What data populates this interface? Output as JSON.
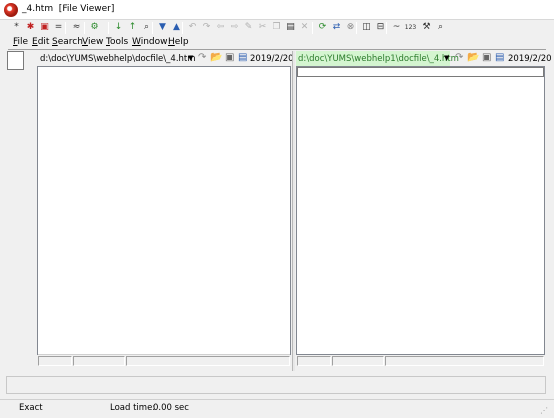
{
  "window": {
    "title": "_4.htm  [File Viewer]"
  },
  "toolbar": {
    "buttons": [
      {
        "icon": "asterisk-icon",
        "glyph": "*"
      },
      {
        "icon": "red-asterisk-icon",
        "glyph": "✱"
      },
      {
        "icon": "red-box-icon",
        "glyph": "▣"
      },
      {
        "icon": "equals-icon",
        "glyph": "="
      },
      {
        "icon": "approx-icon",
        "glyph": "≈"
      },
      {
        "icon": "green-gear-icon",
        "glyph": "⚙"
      },
      {
        "icon": "down-arrow-icon",
        "glyph": "↓"
      },
      {
        "icon": "up-arrow-icon",
        "glyph": "↑"
      },
      {
        "icon": "binoculars-icon",
        "glyph": "⌕"
      },
      {
        "icon": "down-triangle-icon",
        "glyph": "▼"
      },
      {
        "icon": "up-triangle-icon",
        "glyph": "▲"
      },
      {
        "icon": "undo-icon",
        "glyph": "↶"
      },
      {
        "icon": "redo-icon",
        "glyph": "↷"
      },
      {
        "icon": "back-icon",
        "glyph": "⇦"
      },
      {
        "icon": "forward-icon",
        "glyph": "⇨"
      },
      {
        "icon": "pencil-icon",
        "glyph": "✎"
      },
      {
        "icon": "scissors-icon",
        "glyph": "✂"
      },
      {
        "icon": "copy-icon",
        "glyph": "❐"
      },
      {
        "icon": "paste-icon",
        "glyph": "▤"
      },
      {
        "icon": "delete-icon",
        "glyph": "✕"
      },
      {
        "icon": "refresh-icon",
        "glyph": "⟳"
      },
      {
        "icon": "swap-icon",
        "glyph": "⇄"
      },
      {
        "icon": "stop-icon",
        "glyph": "⊗"
      },
      {
        "icon": "split-vertical-icon",
        "glyph": "◫"
      },
      {
        "icon": "split-horizontal-icon",
        "glyph": "⊟"
      },
      {
        "icon": "tilde-icon",
        "glyph": "~"
      },
      {
        "icon": "number-icon",
        "glyph": "123"
      },
      {
        "icon": "options-icon",
        "glyph": "⚒"
      },
      {
        "icon": "magnifier-icon",
        "glyph": "⌕"
      }
    ]
  },
  "menu": {
    "items": [
      "File",
      "Edit",
      "Search",
      "View",
      "Tools",
      "Window",
      "Help"
    ]
  },
  "left_pane": {
    "path": "d:\\doc\\YUMS\\webhelp\\docfile\\_4.htm",
    "date": "2019/2/20"
  },
  "right_pane": {
    "path": "d:\\doc\\YUMS\\webhelp1\\docfile\\_4.htm",
    "date": "2019/2/20"
  },
  "statusbar": {
    "mode": "Exact",
    "load_label": "Load time:",
    "load_value": "0.00 sec"
  },
  "colors": {
    "right_path_bg": "#d4f5d0",
    "right_path_fg": "#2a7a2a"
  }
}
